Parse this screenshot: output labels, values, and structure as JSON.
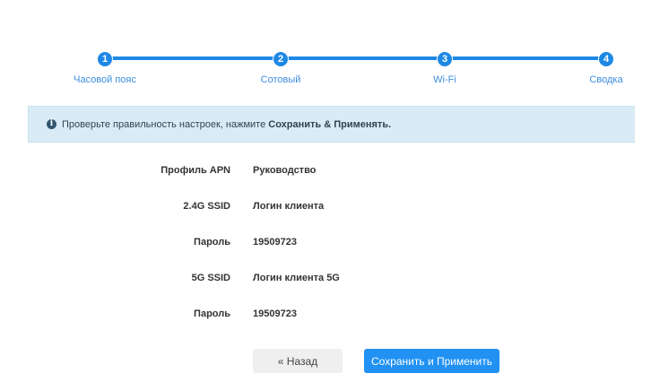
{
  "steps": [
    {
      "num": "1",
      "label": "Часовой пояс"
    },
    {
      "num": "2",
      "label": "Сотовый"
    },
    {
      "num": "3",
      "label": "Wi-Fi"
    },
    {
      "num": "4",
      "label": "Сводка"
    }
  ],
  "alert": {
    "icon": "info-icon",
    "text": "Проверьте правильность настроек, нажмите ",
    "bold": "Сохранить & Применять."
  },
  "summary": [
    {
      "label": "Профиль APN",
      "value": "Руководство"
    },
    {
      "label": "2.4G SSID",
      "value": "Логин клиента"
    },
    {
      "label": "Пароль",
      "value": "19509723"
    },
    {
      "label": "5G SSID",
      "value": "Логин клиента 5G"
    },
    {
      "label": "Пароль",
      "value": "19509723"
    }
  ],
  "buttons": {
    "back": "« Назад",
    "save": "Сохранить и Применить"
  },
  "colors": {
    "accent": "#1e88e5",
    "alert_bg": "#d9ecf5"
  }
}
